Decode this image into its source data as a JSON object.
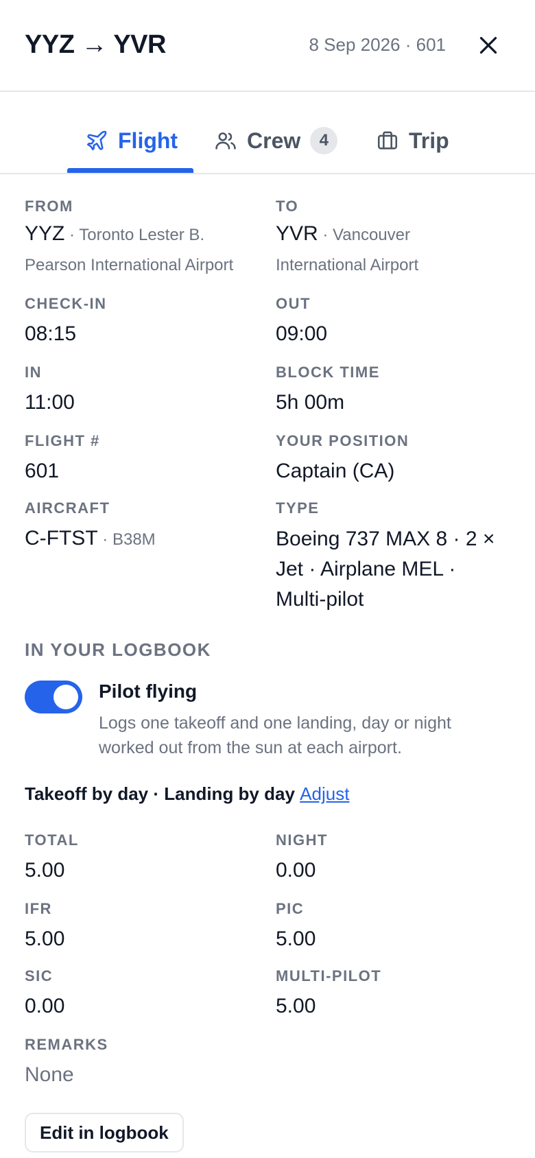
{
  "header": {
    "title": "YYZ → YVR",
    "subtitle": "8 Sep 2026 · 601",
    "close_icon": "close-icon"
  },
  "tabs": [
    {
      "label": "Flight",
      "icon": "plane-icon",
      "active": true
    },
    {
      "label": "Crew",
      "icon": "users-icon",
      "badge": "4"
    },
    {
      "label": "Trip",
      "icon": "briefcase-icon"
    }
  ],
  "flight": {
    "from": {
      "label": "FROM",
      "code": "YYZ",
      "sep": " · ",
      "name": "Toronto Lester B. Pearson International Airport"
    },
    "to": {
      "label": "TO",
      "code": "YVR",
      "sep": " · ",
      "name": "Vancouver International Airport"
    },
    "checkin": {
      "label": "CHECK-IN",
      "value": "08:15"
    },
    "out": {
      "label": "OUT",
      "value": "09:00"
    },
    "in": {
      "label": "IN",
      "value": "11:00"
    },
    "block_time": {
      "label": "BLOCK TIME",
      "value": "5h 00m"
    },
    "flight_number": {
      "label": "FLIGHT #",
      "value": "601"
    },
    "position": {
      "label": "YOUR POSITION",
      "value": "Captain (CA)"
    },
    "aircraft": {
      "label": "AIRCRAFT",
      "value": "C-FTST",
      "sep": " · ",
      "sub": "B38M"
    },
    "type": {
      "label": "TYPE",
      "value": "Boeing 737 MAX 8 · 2 × Jet · Airplane MEL · Multi-pilot"
    }
  },
  "logbook": {
    "section_title": "IN YOUR LOGBOOK",
    "toggle_on": true,
    "pilot_flying_title": "Pilot flying",
    "pilot_flying_desc": "Logs one takeoff and one landing, day or night worked out from the sun at each airport.",
    "summary": "Takeoff by day · Landing by day",
    "adjust_label": "Adjust",
    "total": {
      "label": "TOTAL",
      "value": "5.00"
    },
    "night": {
      "label": "NIGHT",
      "value": "0.00"
    },
    "ifr": {
      "label": "IFR",
      "value": "5.00"
    },
    "pic": {
      "label": "PIC",
      "value": "5.00"
    },
    "sic": {
      "label": "SIC",
      "value": "0.00"
    },
    "multi_pilot": {
      "label": "MULTI-PILOT",
      "value": "5.00"
    },
    "remarks": {
      "label": "REMARKS",
      "value": "None"
    },
    "edit_label": "Edit in logbook"
  },
  "colors": {
    "accent": "#2563eb",
    "muted": "#6b7280",
    "text": "#111827",
    "border": "#e5e7eb"
  }
}
